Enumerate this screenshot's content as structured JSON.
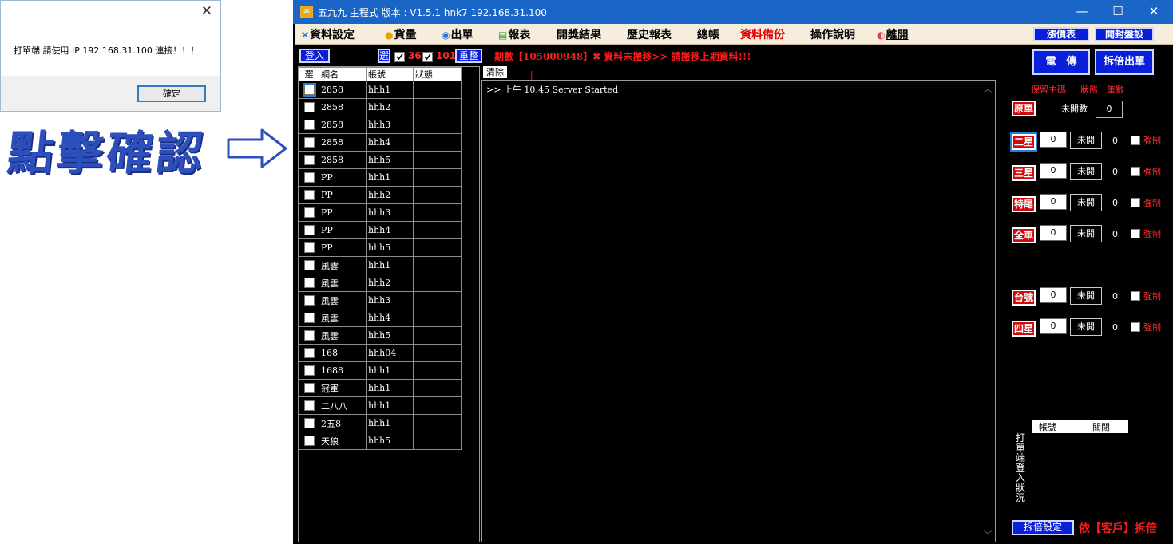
{
  "dialog": {
    "close_glyph": "✕",
    "message": "打單端 請使用 IP  192.168.31.100  連接！！！",
    "ok_label": "確定"
  },
  "annotation": {
    "text": "點擊確認"
  },
  "window": {
    "title": "五九九 主程式  版本 : V1.5.1    hnk7   192.168.31.100",
    "controls": {
      "minimize": "—",
      "maximize": "☐",
      "close": "✕"
    }
  },
  "menu": {
    "items": [
      {
        "icon": "✕",
        "label": "資料設定",
        "color": "#000000"
      },
      {
        "icon": "●",
        "label": "貨量",
        "color": "#000000"
      },
      {
        "icon": "◉",
        "label": "出單",
        "color": "#000000"
      },
      {
        "icon": "▤",
        "label": "報表",
        "color": "#000000"
      },
      {
        "icon": "",
        "label": "開獎結果",
        "color": "#000000"
      },
      {
        "icon": "",
        "label": "歷史報表",
        "color": "#000000"
      },
      {
        "icon": "",
        "label": "總帳",
        "color": "#000000"
      },
      {
        "icon": "",
        "label": "資料備份",
        "color": "#e00000"
      },
      {
        "icon": "",
        "label": "操作說明",
        "color": "#000000"
      },
      {
        "icon": "◐",
        "label": "離開",
        "color": "#000000"
      }
    ],
    "right_buttons": [
      "漲價表",
      "開封盤設"
    ]
  },
  "toolbar": {
    "login_label": "登入",
    "select_label": "選",
    "count_a": "36",
    "count_b": "101",
    "reset_label": "重整",
    "notice": "期數【105000948】✖ 資料未搬移>> 請搬移上期資料!!!"
  },
  "buttons": {
    "telegram": "電　傳",
    "split_order": "拆倍出單",
    "split_setting": "拆倍設定"
  },
  "legend": {
    "keep_main": "保留主碼",
    "status": "狀態",
    "count": "筆數"
  },
  "list": {
    "headers": [
      "選",
      "網名",
      "帳號",
      "狀態"
    ],
    "rows": [
      {
        "net": "2858",
        "account": "hhh1",
        "status": ""
      },
      {
        "net": "2858",
        "account": "hhh2",
        "status": ""
      },
      {
        "net": "2858",
        "account": "hhh3",
        "status": ""
      },
      {
        "net": "2858",
        "account": "hhh4",
        "status": ""
      },
      {
        "net": "2858",
        "account": "hhh5",
        "status": ""
      },
      {
        "net": "PP",
        "account": "hhh1",
        "status": ""
      },
      {
        "net": "PP",
        "account": "hhh2",
        "status": ""
      },
      {
        "net": "PP",
        "account": "hhh3",
        "status": ""
      },
      {
        "net": "PP",
        "account": "hhh4",
        "status": ""
      },
      {
        "net": "PP",
        "account": "hhh5",
        "status": ""
      },
      {
        "net": "風雲",
        "account": "hhh1",
        "status": ""
      },
      {
        "net": "風雲",
        "account": "hhh2",
        "status": ""
      },
      {
        "net": "風雲",
        "account": "hhh3",
        "status": ""
      },
      {
        "net": "風雲",
        "account": "hhh4",
        "status": ""
      },
      {
        "net": "風雲",
        "account": "hhh5",
        "status": ""
      },
      {
        "net": "168",
        "account": "hhh04",
        "status": ""
      },
      {
        "net": "1688",
        "account": "hhh1",
        "status": ""
      },
      {
        "net": "冠軍",
        "account": "hhh1",
        "status": ""
      },
      {
        "net": "二八八",
        "account": "hhh1",
        "status": ""
      },
      {
        "net": "2五8",
        "account": "hhh1",
        "status": ""
      },
      {
        "net": "天狼",
        "account": "hhh5",
        "status": ""
      }
    ]
  },
  "log": {
    "clear_label": "清除",
    "cursor_mark": "|",
    "lines": [
      ">> 上午 10:45 Server Started"
    ]
  },
  "original": {
    "label": "原單",
    "unopened_label": "未開數",
    "unopened_value": "0"
  },
  "bet_types": [
    {
      "label": "二星",
      "value": "0",
      "open_label": "未開",
      "count": "0",
      "force_label": "強制"
    },
    {
      "label": "三星",
      "value": "0",
      "open_label": "未開",
      "count": "0",
      "force_label": "強制"
    },
    {
      "label": "特尾",
      "value": "0",
      "open_label": "未開",
      "count": "0",
      "force_label": "強制"
    },
    {
      "label": "全車",
      "value": "0",
      "open_label": "未開",
      "count": "0",
      "force_label": "強制"
    },
    {
      "label": "台號",
      "value": "0",
      "open_label": "未開",
      "count": "0",
      "force_label": "強制"
    },
    {
      "label": "四星",
      "value": "0",
      "open_label": "未開",
      "count": "0",
      "force_label": "強制"
    }
  ],
  "client_status": {
    "vertical_label": "打單端登入狀況",
    "headers": [
      "帳號",
      "關閉"
    ]
  },
  "footer_notice": "依【客戶】拆倍"
}
